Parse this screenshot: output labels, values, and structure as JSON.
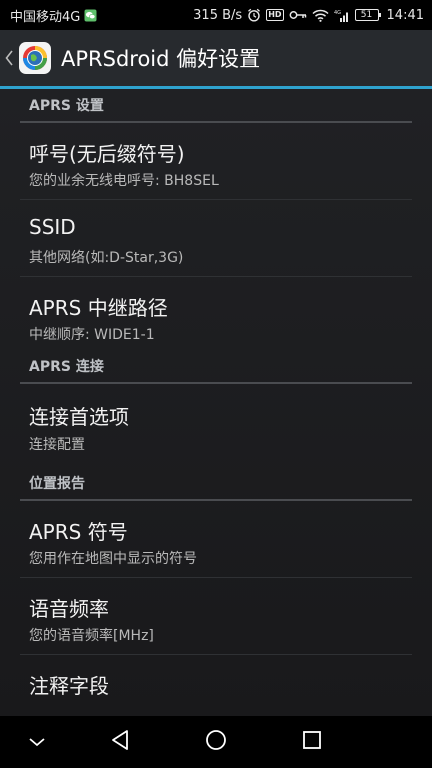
{
  "status_bar": {
    "carrier": "中国移动4G",
    "network_speed": "315 B/s",
    "hd_label": "HD",
    "signal_label": "4G",
    "battery": "51",
    "time": "14:41"
  },
  "action_bar": {
    "title": "APRSdroid 偏好设置"
  },
  "sections": [
    {
      "category": "APRS 设置",
      "items": [
        {
          "title": "呼号(无后缀符号)",
          "summary": "您的业余无线电呼号: BH8SEL"
        },
        {
          "title": "SSID",
          "summary": "其他网络(如:D-Star,3G)"
        },
        {
          "title": "APRS 中继路径",
          "summary": "中继顺序: WIDE1-1"
        }
      ]
    },
    {
      "category": "APRS 连接",
      "items": [
        {
          "title": "连接首选项",
          "summary": "连接配置"
        }
      ]
    },
    {
      "category": "位置报告",
      "items": [
        {
          "title": "APRS 符号",
          "summary": "您用作在地图中显示的符号"
        },
        {
          "title": "语音频率",
          "summary": "您的语音频率[MHz]"
        },
        {
          "title": "注释字段",
          "summary": ""
        }
      ]
    }
  ],
  "colors": {
    "accent": "#2fa3cf",
    "action_bar": "#272a2e",
    "background": "#1d1e20"
  },
  "nav_bar": {
    "icons": [
      "chevron-down-icon",
      "back-triangle-icon",
      "home-circle-icon",
      "recents-square-icon"
    ]
  }
}
